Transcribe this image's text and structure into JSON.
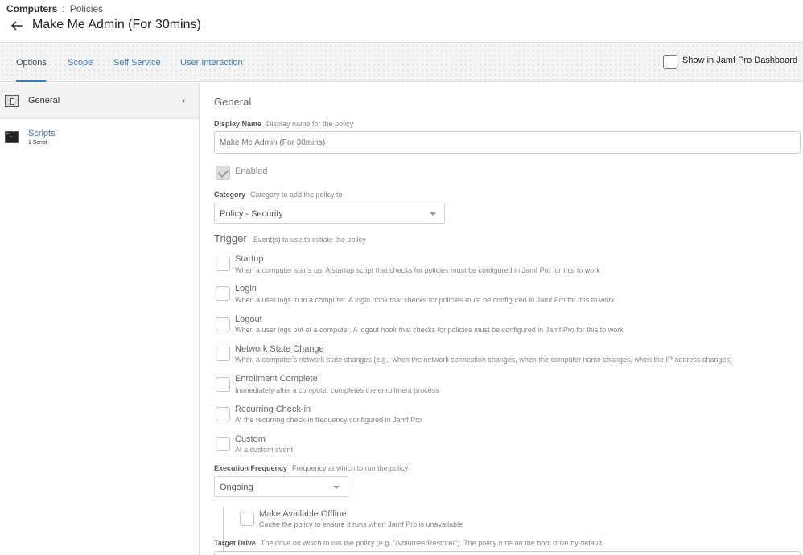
{
  "breadcrumb": {
    "root": "Computers",
    "separator": ":",
    "current": "Policies"
  },
  "header": {
    "title": "Make Me Admin (For 30mins)"
  },
  "tabs": [
    {
      "label": "Options",
      "active": true
    },
    {
      "label": "Scope",
      "active": false
    },
    {
      "label": "Self Service",
      "active": false
    },
    {
      "label": "User Interaction",
      "active": false
    }
  ],
  "dashboard": {
    "label": "Show in Jamf Pro Dashboard",
    "checked": false
  },
  "sidebar": {
    "items": [
      {
        "label": "General",
        "icon": "general-icon",
        "selected": true
      },
      {
        "label": "Scripts",
        "sublabel": "1 Script",
        "icon": "terminal-icon",
        "selected": false
      }
    ]
  },
  "general": {
    "section_title": "General",
    "display_name": {
      "label": "Display Name",
      "help": "Display name for the policy",
      "placeholder": "Make Me Admin (For 30mins)"
    },
    "enabled": {
      "label": "Enabled",
      "checked": true
    },
    "category": {
      "label": "Category",
      "help": "Category to add the policy to",
      "value": "Policy - Security"
    },
    "trigger": {
      "title": "Trigger",
      "help": "Event(s) to use to initiate the policy",
      "items": [
        {
          "name": "Startup",
          "desc": "When a computer starts up. A startup script that checks for policies must be configured in Jamf Pro for this to work",
          "checked": false
        },
        {
          "name": "Login",
          "desc": "When a user logs in to a computer. A login hook that checks for policies must be configured in Jamf Pro for this to work",
          "checked": false
        },
        {
          "name": "Logout",
          "desc": "When a user logs out of a computer. A logout hook that checks for policies must be configured in Jamf Pro for this to work",
          "checked": false
        },
        {
          "name": "Network State Change",
          "desc": "When a computer's network state changes (e.g., when the network connection changes, when the computer name changes, when the IP address changes)",
          "checked": false
        },
        {
          "name": "Enrollment Complete",
          "desc": "Immediately after a computer completes the enrollment process",
          "checked": false
        },
        {
          "name": "Recurring Check-in",
          "desc": "At the recurring check-in frequency configured in Jamf Pro",
          "checked": false
        },
        {
          "name": "Custom",
          "desc": "At a custom event",
          "checked": false
        }
      ]
    },
    "execution_frequency": {
      "label": "Execution Frequency",
      "help": "Frequency at which to run the policy",
      "value": "Ongoing"
    },
    "offline": {
      "name": "Make Available Offline",
      "desc": "Cache the policy to ensure it runs when Jamf Pro is unavailable",
      "checked": false
    },
    "target_drive": {
      "label": "Target Drive",
      "help": "The drive on which to run the policy (e.g. \"/Volumes/Restore/\"). The policy runs on the boot drive by default"
    }
  },
  "colors": {
    "link": "#3b78c3",
    "tab_active_underline": "#3b78c3"
  }
}
